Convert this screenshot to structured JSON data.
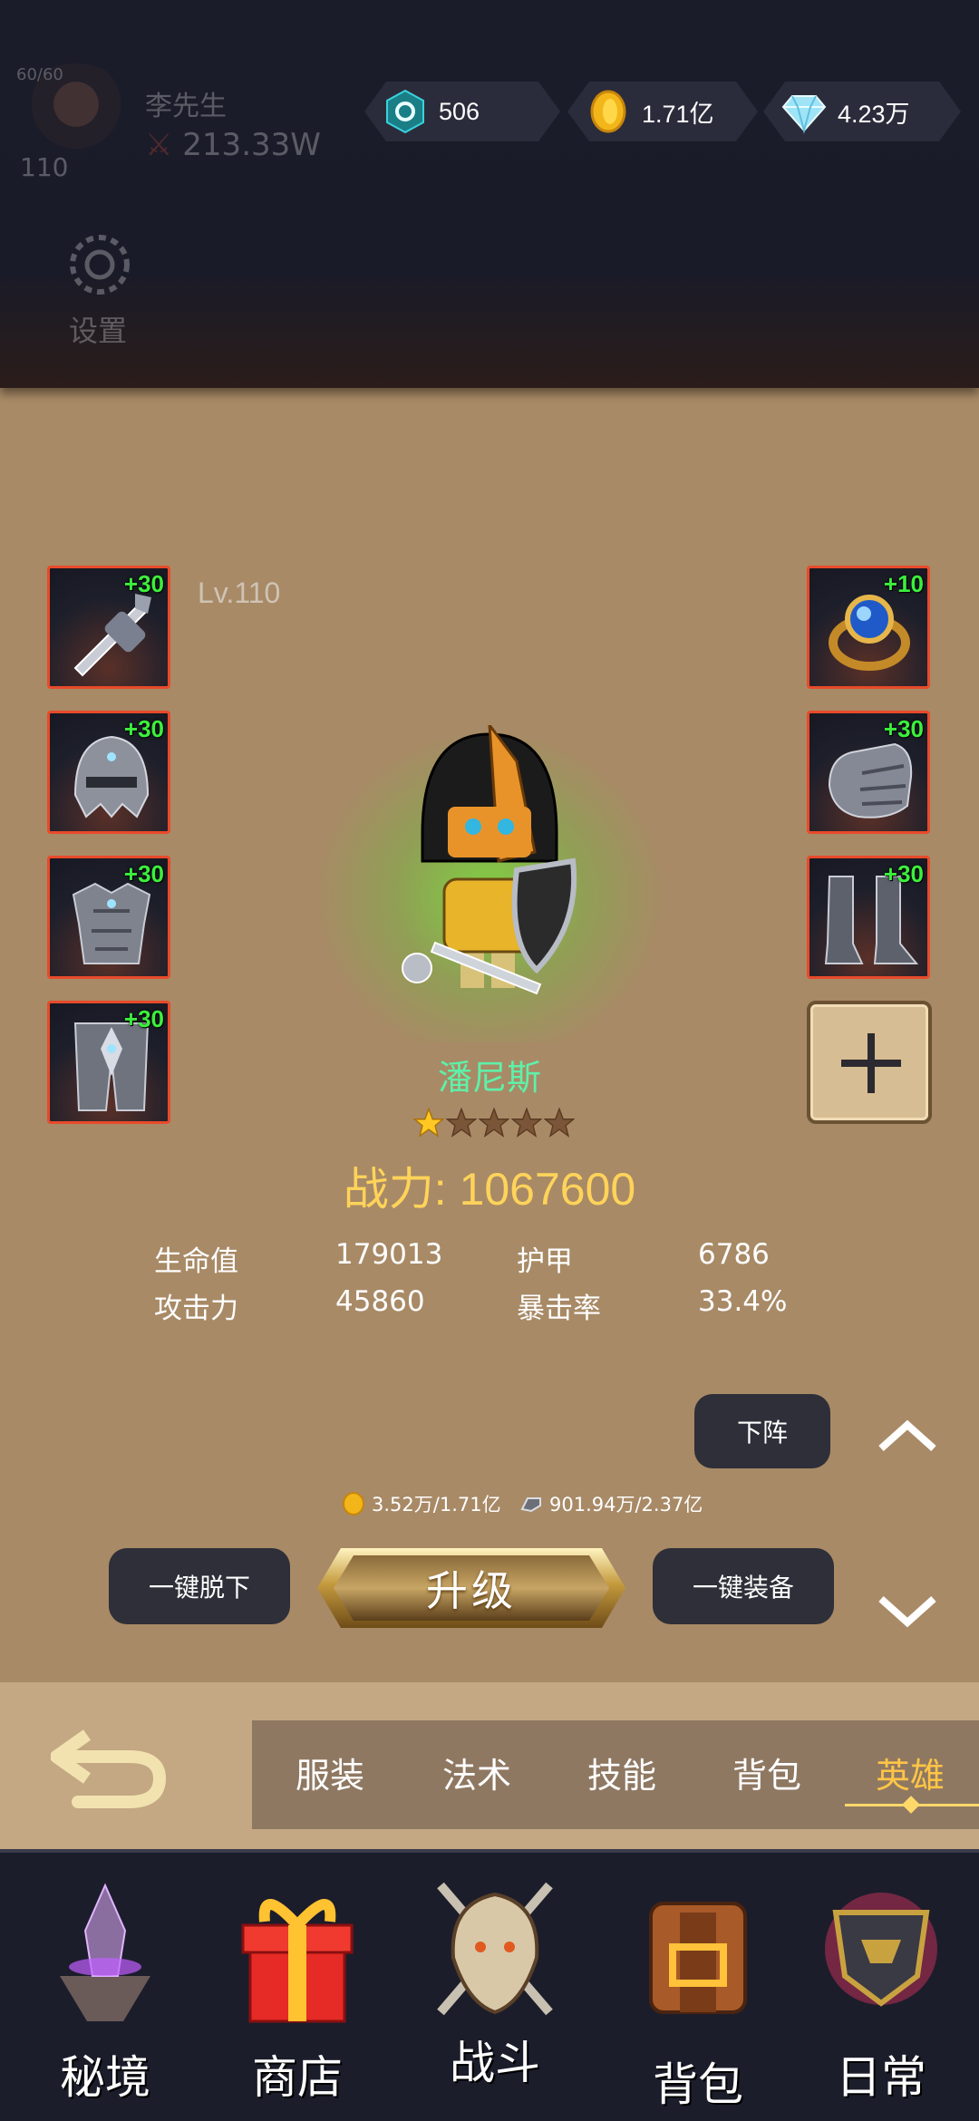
{
  "header": {
    "level_tiny": "60/60",
    "player_level": "110",
    "player_name": "李先生",
    "player_power": "213.33W",
    "settings_label": "设置",
    "resources": [
      {
        "icon": "gem-token-icon",
        "value": "506"
      },
      {
        "icon": "gold-coin-icon",
        "value": "1.71亿"
      },
      {
        "icon": "diamond-icon",
        "value": "4.23万"
      }
    ]
  },
  "hero": {
    "level": "Lv.110",
    "name": "潘尼斯",
    "stars_filled": 1,
    "stars_total": 5,
    "combat_power": "战力: 1067600",
    "left_equipment": [
      {
        "icon": "sword-icon",
        "plus": "+30"
      },
      {
        "icon": "helmet-icon",
        "plus": "+30"
      },
      {
        "icon": "chest-armor-icon",
        "plus": "+30"
      },
      {
        "icon": "leg-armor-icon",
        "plus": "+30"
      }
    ],
    "right_equipment": [
      {
        "icon": "ring-icon",
        "plus": "+10"
      },
      {
        "icon": "gauntlet-icon",
        "plus": "+30"
      },
      {
        "icon": "boots-icon",
        "plus": "+30"
      }
    ],
    "stats": {
      "hp_label": "生命值",
      "hp_value": "179013",
      "armor_label": "护甲",
      "armor_value": "6786",
      "attack_label": "攻击力",
      "attack_value": "45860",
      "crit_label": "暴击率",
      "crit_value": "33.4%"
    }
  },
  "actions": {
    "dismiss_label": "下阵",
    "unequip_all_label": "一键脱下",
    "upgrade_label": "升级",
    "equip_all_label": "一键装备",
    "gold_cost": "3.52万/1.71亿",
    "material_cost": "901.94万/2.37亿"
  },
  "tabs": [
    "服装",
    "法术",
    "技能",
    "背包",
    "英雄"
  ],
  "active_tab": "英雄",
  "bottom_nav": [
    "秘境",
    "商店",
    "战斗",
    "背包",
    "日常"
  ],
  "colors": {
    "panel_bg": "#a88a66",
    "slot_border": "#e84a2a",
    "plus_green": "#3cf03c",
    "hero_name": "#5ff0a8",
    "power_gold": "#ffd35a",
    "active_tab": "#ffc546"
  }
}
